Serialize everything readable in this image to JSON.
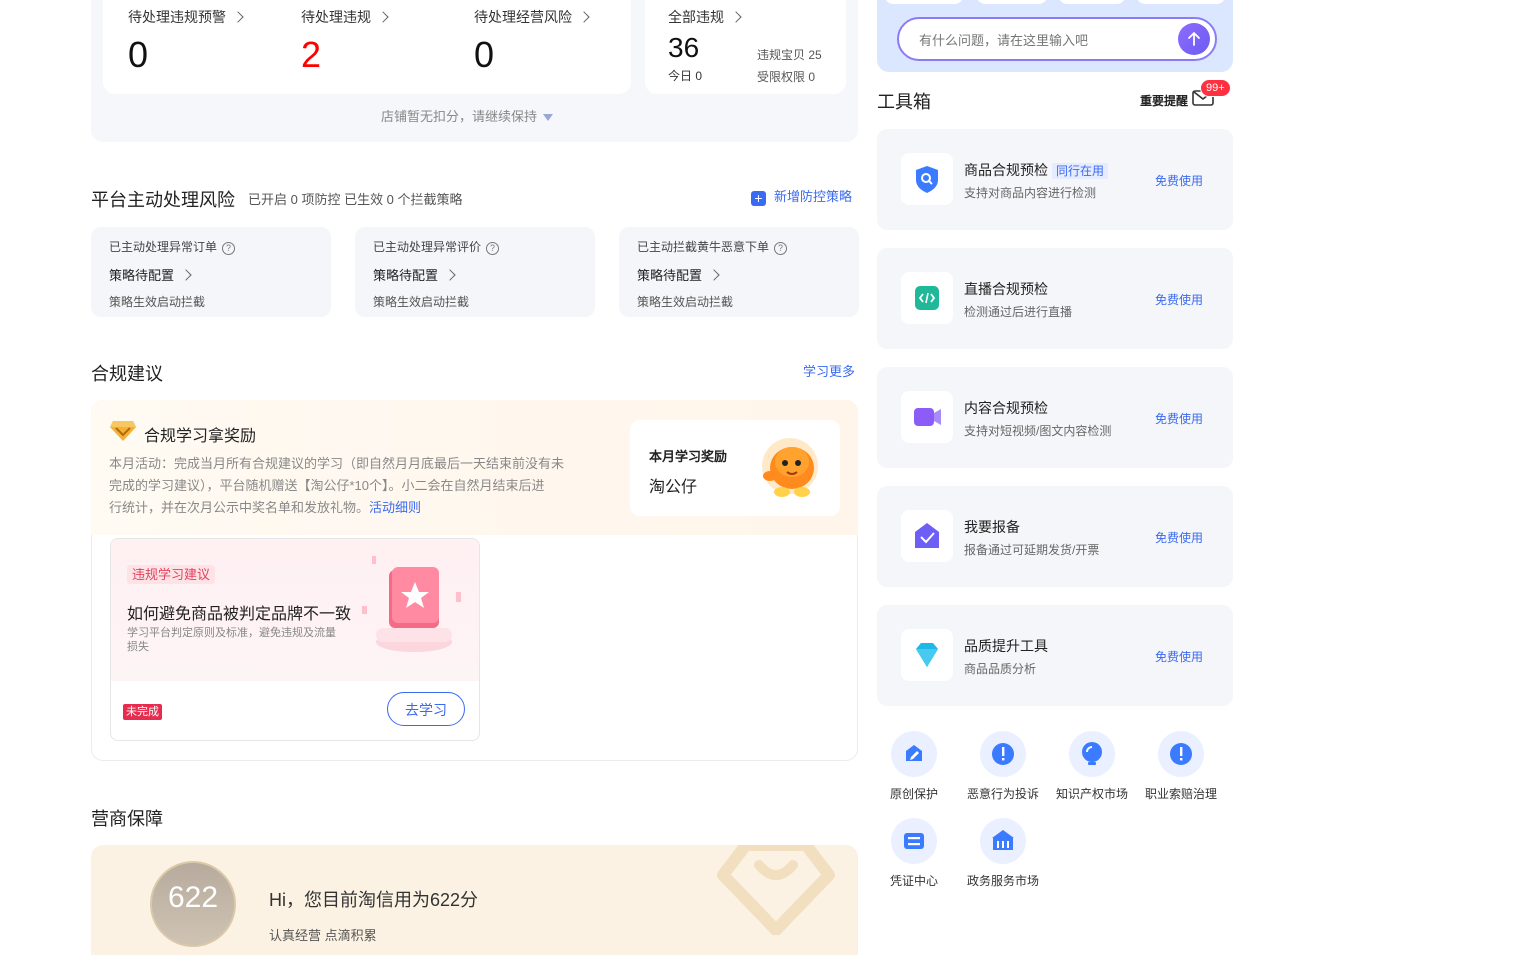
{
  "top_stats": {
    "items": [
      {
        "label": "待处理违规预警",
        "value": "0",
        "red": false
      },
      {
        "label": "待处理违规",
        "value": "2",
        "red": true
      },
      {
        "label": "待处理经营风险",
        "value": "0",
        "red": false
      }
    ],
    "all_violations": {
      "label": "全部违规",
      "value": "36",
      "today": "今日 0",
      "treasure": "违规宝贝 25",
      "restricted": "受限权限 0"
    },
    "notice": "店铺暂无扣分，请继续保持"
  },
  "platform_risk": {
    "title": "平台主动处理风险",
    "summary": "已开启 0 项防控 已生效 0 个拦截策略",
    "add_link": "新增防控策略",
    "cards": [
      {
        "title": "已主动处理异常订单",
        "status": "策略待配置",
        "desc": "策略生效启动拦截"
      },
      {
        "title": "已主动处理异常评价",
        "status": "策略待配置",
        "desc": "策略生效启动拦截"
      },
      {
        "title": "已主动拦截黄牛恶意下单",
        "status": "策略待配置",
        "desc": "策略生效启动拦截"
      }
    ]
  },
  "compliance": {
    "title": "合规建议",
    "more_link": "学习更多",
    "reward_title": "合规学习拿奖励",
    "desc_lines": [
      "本月活动：完成当月所有合规建议的学习（即自然月月底最后一天结束前没有未",
      "完成的学习建议），平台随机赠送【淘公仔*10个】。小二会在自然月结束后进",
      "行统计，并在次月公示中奖名单和发放礼物。"
    ],
    "rules_link": "活动细则",
    "monthly_label": "本月学习奖励",
    "monthly_prize": "淘公仔",
    "card": {
      "tag": "违规学习建议",
      "title": "如何避免商品被判定品牌不一致",
      "desc_lines": [
        "学习平台判定原则及标准，避免违规及流量",
        "损失"
      ],
      "status": "未完成",
      "button": "去学习"
    }
  },
  "protection": {
    "title": "营商保障",
    "score": "622",
    "greeting": "Hi，您目前淘信用为622分",
    "sub": "认真经营 点滴积累"
  },
  "assistant": {
    "placeholder": "有什么问题，请在这里输入吧"
  },
  "toolbox": {
    "title": "工具箱",
    "reminder": "重要提醒",
    "badge": "99+",
    "tools": [
      {
        "title": "商品合规预检",
        "tag": "同行在用",
        "sub": "支持对商品内容进行检测",
        "link": "免费使用",
        "icon": "shield-search-icon"
      },
      {
        "title": "直播合规预检",
        "tag": "",
        "sub": "检测通过后进行直播",
        "link": "免费使用",
        "icon": "code-icon"
      },
      {
        "title": "内容合规预检",
        "tag": "",
        "sub": "支持对短视频/图文内容检测",
        "link": "免费使用",
        "icon": "video-icon"
      },
      {
        "title": "我要报备",
        "tag": "",
        "sub": "报备通过可延期发货/开票",
        "link": "免费使用",
        "icon": "envelope-check-icon"
      },
      {
        "title": "品质提升工具",
        "tag": "",
        "sub": "商品品质分析",
        "link": "免费使用",
        "icon": "diamond-icon"
      }
    ],
    "services": [
      {
        "label": "原创保护",
        "icon": "pen-icon"
      },
      {
        "label": "恶意行为投诉",
        "icon": "alert-icon"
      },
      {
        "label": "知识产权市场",
        "icon": "bulb-icon"
      },
      {
        "label": "职业索赔治理",
        "icon": "alert-icon"
      },
      {
        "label": "凭证中心",
        "icon": "ticket-icon"
      },
      {
        "label": "政务服务市场",
        "icon": "bank-icon"
      }
    ]
  }
}
